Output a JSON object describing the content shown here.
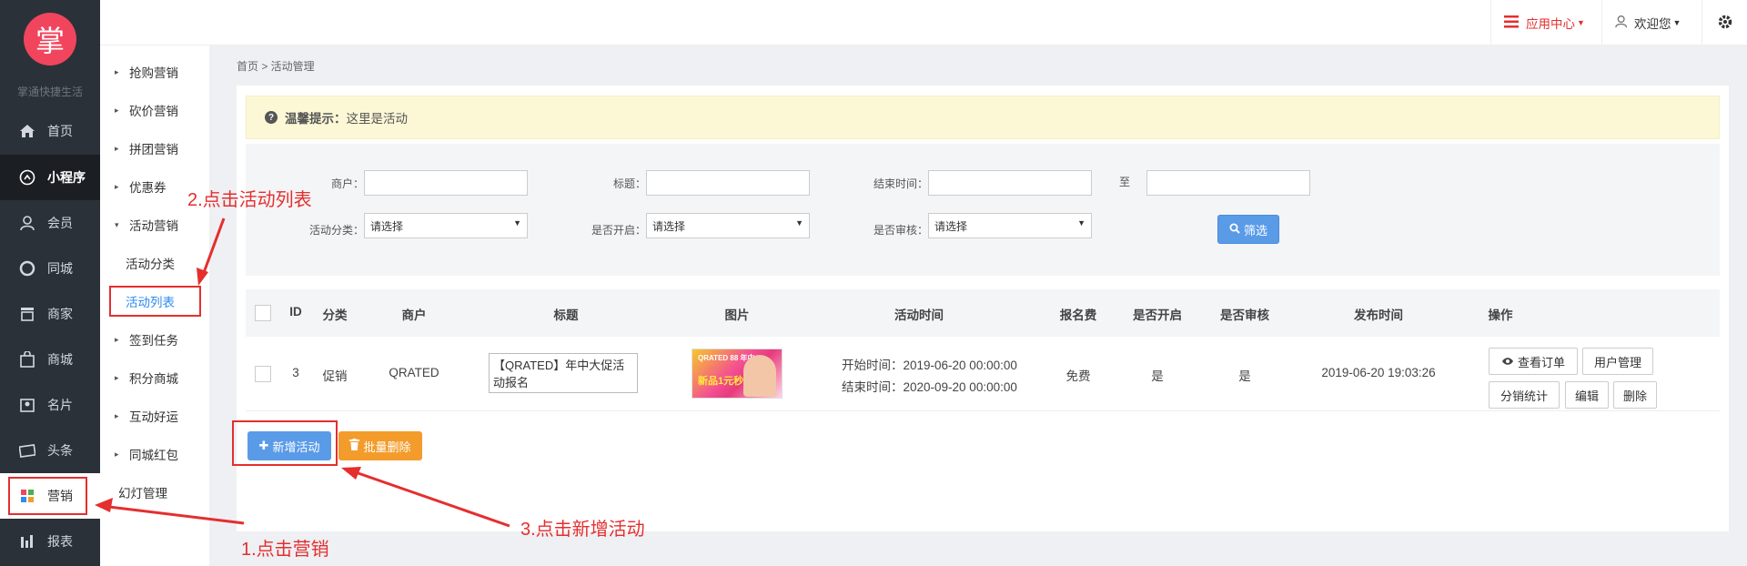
{
  "brand": {
    "logo_char": "掌",
    "name": "掌通快捷生活"
  },
  "sidebar": {
    "items": [
      {
        "label": "首页",
        "icon": "home-icon"
      },
      {
        "label": "小程序",
        "icon": "miniapp-icon"
      },
      {
        "label": "会员",
        "icon": "user-icon"
      },
      {
        "label": "同城",
        "icon": "circle-icon"
      },
      {
        "label": "商家",
        "icon": "store-icon"
      },
      {
        "label": "商城",
        "icon": "shop-icon"
      },
      {
        "label": "名片",
        "icon": "card-icon"
      },
      {
        "label": "头条",
        "icon": "news-icon"
      },
      {
        "label": "营销",
        "icon": "apps-icon"
      },
      {
        "label": "报表",
        "icon": "chart-icon"
      }
    ]
  },
  "submenu": {
    "items": [
      {
        "label": "抢购营销",
        "caret": "▸"
      },
      {
        "label": "砍价营销",
        "caret": "▸"
      },
      {
        "label": "拼团营销",
        "caret": "▸"
      },
      {
        "label": "优惠券",
        "caret": "▸"
      },
      {
        "label": "活动营销",
        "caret": "▾"
      },
      {
        "label": "活动分类",
        "caret": ""
      },
      {
        "label": "活动列表",
        "caret": ""
      },
      {
        "label": "签到任务",
        "caret": "▸"
      },
      {
        "label": "积分商城",
        "caret": "▸"
      },
      {
        "label": "互动好运",
        "caret": "▸"
      },
      {
        "label": "同城红包",
        "caret": "▸"
      },
      {
        "label": "幻灯管理",
        "caret": ""
      }
    ]
  },
  "topbar": {
    "app_center": "应用中心",
    "welcome": "欢迎您"
  },
  "breadcrumb": "首页 > 活动管理",
  "tip": {
    "label": "温馨提示：",
    "text": "这里是活动"
  },
  "filter": {
    "merchant_label": "商户：",
    "title_label": "标题：",
    "end_time_label": "结束时间：",
    "to_label": "至",
    "category_label": "活动分类：",
    "open_label": "是否开启：",
    "review_label": "是否审核：",
    "select_placeholder": "请选择",
    "filter_button": "筛选"
  },
  "table": {
    "headers": [
      "ID",
      "分类",
      "商户",
      "标题",
      "图片",
      "活动时间",
      "报名费",
      "是否开启",
      "是否审核",
      "发布时间",
      "操作"
    ],
    "row": {
      "id": "3",
      "category": "促销",
      "merchant": "QRATED",
      "title": "【QRATED】年中大促活动报名",
      "image_text_top": "QRATED 88 年中",
      "image_text": "新品1元秒",
      "start_time": "开始时间：2019-06-20 00:00:00",
      "end_time": "结束时间：2020-09-20 00:00:00",
      "fee": "免费",
      "open": "是",
      "review": "是",
      "published": "2019-06-20 19:03:26",
      "ops": {
        "view_orders": "查看订单",
        "user_manage": "用户管理",
        "dist_stats": "分销统计",
        "edit": "编辑",
        "delete": "删除"
      }
    }
  },
  "actions": {
    "add": "新增活动",
    "batch_delete": "批量删除"
  },
  "annotations": {
    "step1": "1.点击营销",
    "step2": "2.点击活动列表",
    "step3": "3.点击新增活动"
  },
  "colors": {
    "accent_red": "#e52e2e",
    "primary_blue": "#5a9be8",
    "warning_orange": "#f39c2b",
    "logo_red": "#f0455d",
    "sidebar_dark": "#2b3139"
  }
}
